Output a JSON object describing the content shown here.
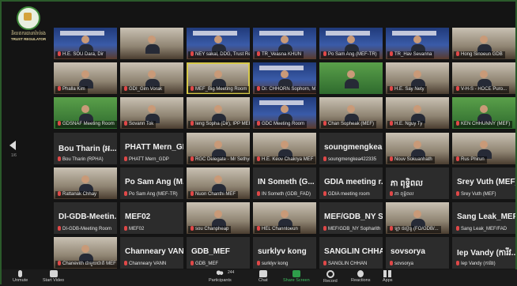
{
  "logo": {
    "khmer": "និយតករធានារ៉ាប់រង",
    "english": "TRUST REGULATOR"
  },
  "nav": {
    "page_indicator": "1/6"
  },
  "tiles": [
    [
      "H.E. SOU Dara, Dir",
      "",
      "NEY sakal, DDG, Trust Re",
      "TR_Veasna KHUN",
      "Po Sam Ang (MEF-TR)",
      "TR_Hav Sevanna",
      "Hong Sinoeun GDB"
    ],
    [
      "Phalla Kim",
      "GDI_Gim Vorak",
      "MEF_Big Meeting Room",
      "Dr. CHHORN Sophorn, M...",
      "",
      "H.E. Say Nety",
      "V-H-S - HOCE Puro..."
    ],
    [
      "GDSNAF Meeting Room",
      "Sovann Tok",
      "Ieng Sopha (Dir), IPP MEF",
      "GDC Meeting Room",
      "Chan Sopheak (MEF)",
      "H.E. Nguy Ty",
      "KEN CHHUNNY (MEF)"
    ],
    [
      "Bou Tharin (RPHA)",
      "PHATT Mern_GDP",
      "RGC Delegate - Mr Sethyra",
      "H.E. Keov Chakrya MEF",
      "soungmengkea422335",
      "Nouv Sokuanhath",
      "Rus Phirun"
    ],
    [
      "Rattanak Chhay",
      "Po Sam Ang (MEF-TR)",
      "Nuon Chanthi MEF",
      "IN Someth (GDB_FAD)",
      "GDIA meeting room",
      "ភា ពុទ្ធិពល",
      "Srey Vuth (MEF)"
    ],
    [
      "DI-GDB-Meeting Room",
      "MEF02",
      "sou Chanpheap",
      "HEL Channtoeun",
      "MEF/GDB_NY Sopharith",
      "ឡា ផល្លីនូ (FO/GDB/...",
      "Sang Leak_MEF/FAD"
    ],
    [
      "Chanevith ជាមួយជាតិ MEF",
      "Channeary VANN",
      "GDB_MEF",
      "surklyv kong",
      "SANGLIN CHHAN",
      "sovsorya",
      "Iep Vandy (ការីវរ)"
    ]
  ],
  "bignames": {
    "r3": [
      "Bou Tharin (អ...",
      "PHATT Mern_GDP",
      "",
      "",
      "soungmengkea...",
      "",
      ""
    ],
    "r4": [
      "",
      "Po Sam Ang (M...",
      "",
      "IN Someth (G...",
      "GDIA meeting r...",
      "ភា ពុទ្ធិពល",
      "Srey Vuth (MEF)"
    ],
    "r5": [
      "DI-GDB-Meetin...",
      "MEF02",
      "",
      "",
      "MEF/GDB_NY S...",
      "",
      "Sang Leak_MEF..."
    ],
    "r6": [
      "",
      "Channeary VANN",
      "GDB_MEF",
      "surklyv kong",
      "SANGLIN CHHAN",
      "sovsorya",
      "Iep Vandy (ការីវ..."
    ]
  },
  "toolbar": {
    "unmute": "Unmute",
    "start_video": "Start Video",
    "participants": "Participants",
    "participants_count": "244",
    "chat": "Chat",
    "share_screen": "Share Screen",
    "record": "Record",
    "reactions": "Reactions",
    "apps": "Apps"
  },
  "colors": {
    "accent": "#2e9e4a",
    "mic_muted": "#e04848",
    "frame": "#2b5a2b"
  }
}
